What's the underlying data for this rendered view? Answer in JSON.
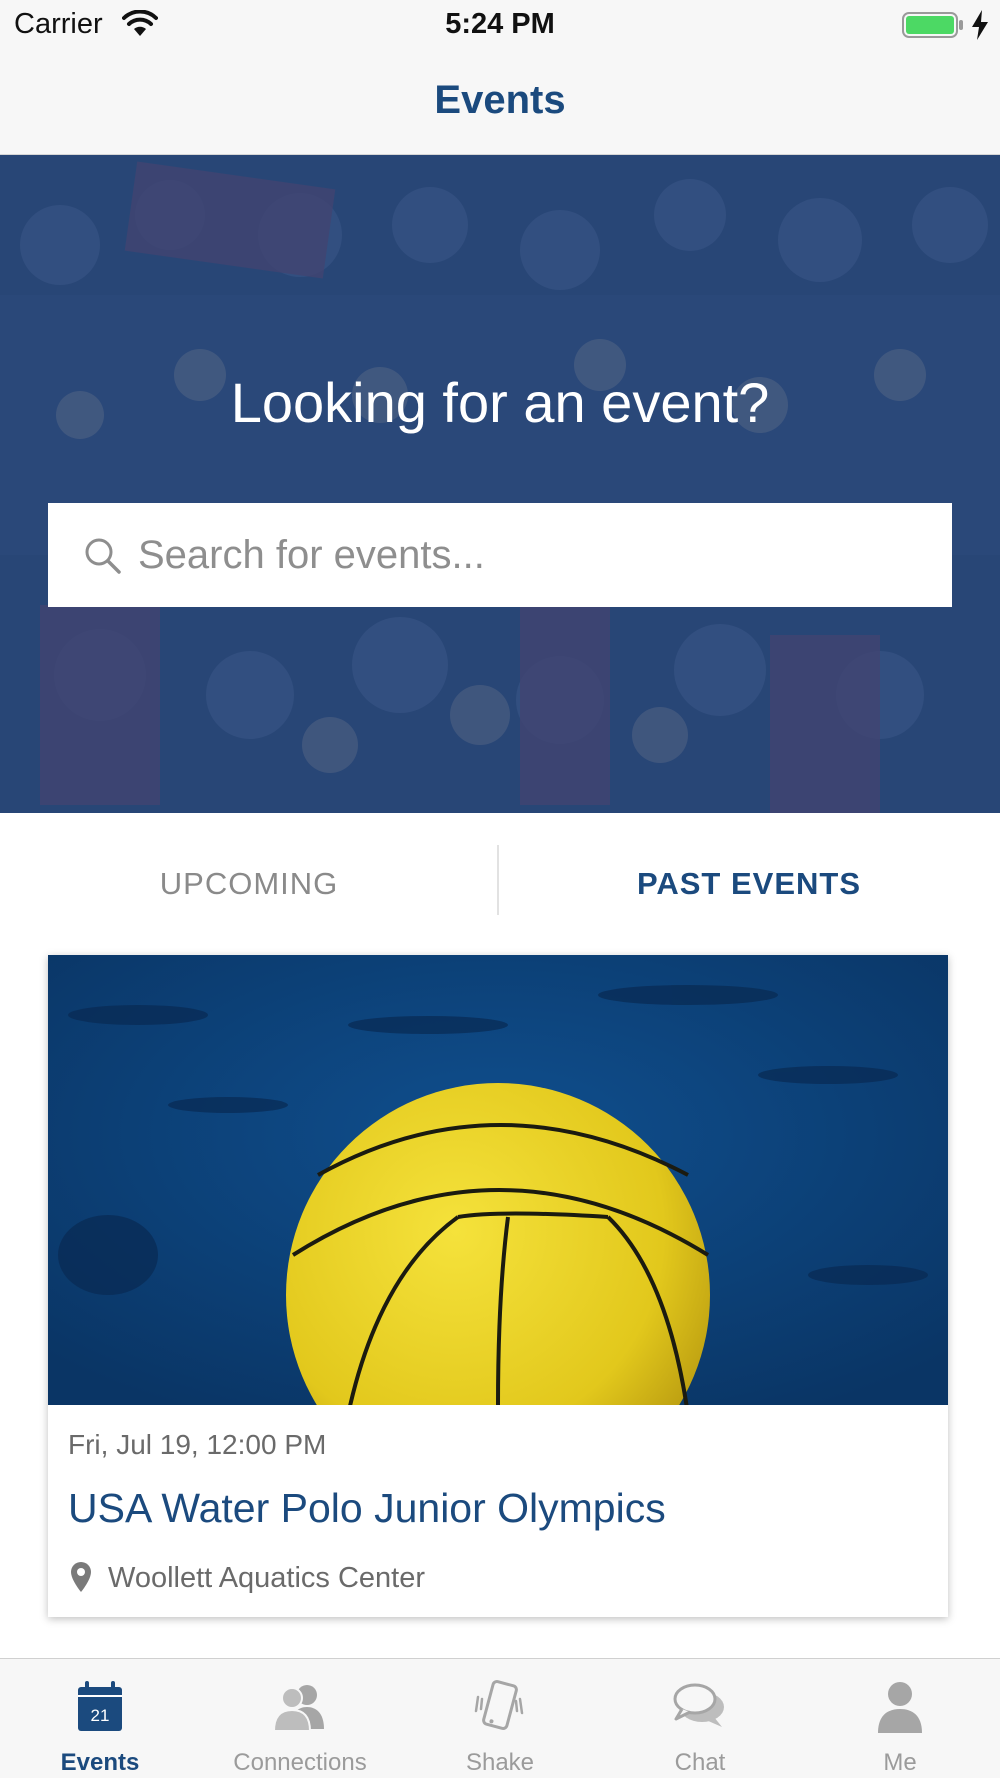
{
  "status_bar": {
    "carrier": "Carrier",
    "time": "5:24 PM",
    "battery_color": "#4cd964"
  },
  "nav": {
    "title": "Events"
  },
  "hero": {
    "title": "Looking for an event?",
    "search_placeholder": "Search for events..."
  },
  "tabs": {
    "upcoming": "UPCOMING",
    "past": "PAST EVENTS",
    "selected": "past"
  },
  "events": [
    {
      "date": "Fri, Jul 19, 12:00 PM",
      "title": "USA Water Polo Junior Olympics",
      "venue": "Woollett Aquatics Center"
    }
  ],
  "tab_bar": {
    "items": [
      {
        "label": "Events",
        "icon": "calendar-icon",
        "calendar_day": "21",
        "active": true
      },
      {
        "label": "Connections",
        "icon": "people-icon",
        "active": false
      },
      {
        "label": "Shake",
        "icon": "phone-shake-icon",
        "active": false
      },
      {
        "label": "Chat",
        "icon": "chat-bubbles-icon",
        "active": false
      },
      {
        "label": "Me",
        "icon": "person-icon",
        "active": false
      }
    ]
  },
  "colors": {
    "brand": "#1b4a7e",
    "inactive": "#9b9b9b",
    "hero_overlay": "#1f3e70"
  }
}
